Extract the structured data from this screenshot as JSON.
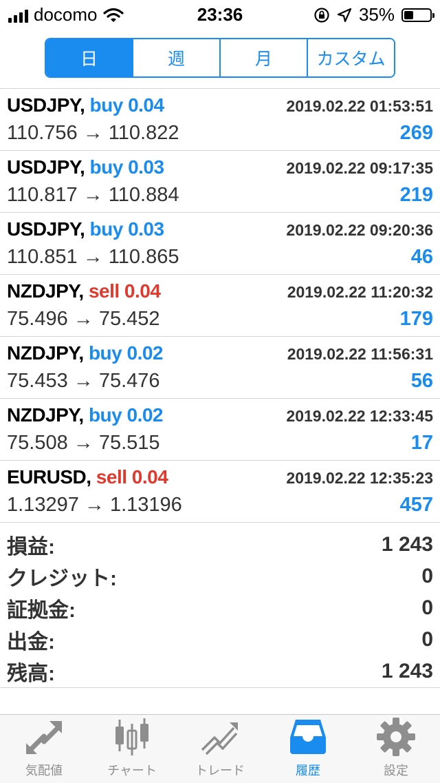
{
  "status_bar": {
    "carrier": "docomo",
    "time": "23:36",
    "battery_percent_text": "35%",
    "battery_level": 0.35
  },
  "segmented": [
    {
      "label": "日",
      "active": true
    },
    {
      "label": "週",
      "active": false
    },
    {
      "label": "月",
      "active": false
    },
    {
      "label": "カスタム",
      "active": false
    }
  ],
  "trades": [
    {
      "symbol": "USDJPY,",
      "side": "buy",
      "volume": "0.04",
      "time": "2019.02.22 01:53:51",
      "prices": "110.756 → 110.822",
      "profit": "269"
    },
    {
      "symbol": "USDJPY,",
      "side": "buy",
      "volume": "0.03",
      "time": "2019.02.22 09:17:35",
      "prices": "110.817 → 110.884",
      "profit": "219"
    },
    {
      "symbol": "USDJPY,",
      "side": "buy",
      "volume": "0.03",
      "time": "2019.02.22 09:20:36",
      "prices": "110.851 → 110.865",
      "profit": "46"
    },
    {
      "symbol": "NZDJPY,",
      "side": "sell",
      "volume": "0.04",
      "time": "2019.02.22 11:20:32",
      "prices": "75.496 → 75.452",
      "profit": "179"
    },
    {
      "symbol": "NZDJPY,",
      "side": "buy",
      "volume": "0.02",
      "time": "2019.02.22 11:56:31",
      "prices": "75.453 → 75.476",
      "profit": "56"
    },
    {
      "symbol": "NZDJPY,",
      "side": "buy",
      "volume": "0.02",
      "time": "2019.02.22 12:33:45",
      "prices": "75.508 → 75.515",
      "profit": "17"
    },
    {
      "symbol": "EURUSD,",
      "side": "sell",
      "volume": "0.04",
      "time": "2019.02.22 12:35:23",
      "prices": "1.13297 → 1.13196",
      "profit": "457"
    }
  ],
  "summary": [
    {
      "label": "損益:",
      "value": "1 243"
    },
    {
      "label": "クレジット:",
      "value": "0"
    },
    {
      "label": "証拠金:",
      "value": "0"
    },
    {
      "label": "出金:",
      "value": "0"
    },
    {
      "label": "残高:",
      "value": "1 243"
    }
  ],
  "tabs": [
    {
      "label": "気配値",
      "icon": "quotes-arrows-icon",
      "active": false
    },
    {
      "label": "チャート",
      "icon": "candlestick-chart-icon",
      "active": false
    },
    {
      "label": "トレード",
      "icon": "trade-trend-icon",
      "active": false
    },
    {
      "label": "履歴",
      "icon": "history-inbox-icon",
      "active": true
    },
    {
      "label": "設定",
      "icon": "gear-icon",
      "active": false
    }
  ],
  "colors": {
    "accent": "#1a8cf0",
    "sell": "#e0392d",
    "inactive_tab": "#8e8e8e"
  }
}
